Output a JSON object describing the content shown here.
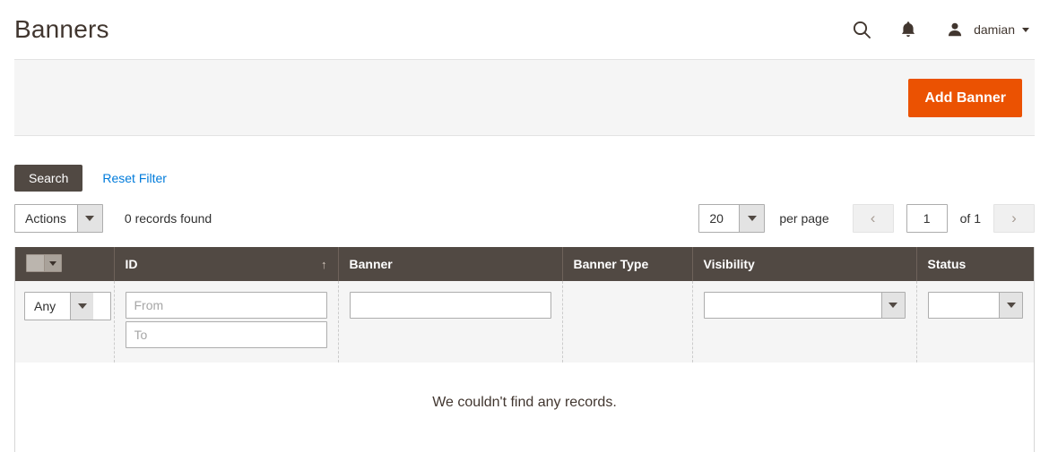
{
  "header": {
    "title": "Banners",
    "search_icon": "search-icon",
    "notifications_icon": "bell-icon",
    "user_icon": "user-icon",
    "user_name": "damian"
  },
  "page_actions": {
    "add_button_label": "Add Banner",
    "accent_color": "#eb5202"
  },
  "filter_actions": {
    "search_label": "Search",
    "reset_label": "Reset Filter",
    "search_bg": "#514943",
    "reset_link_color": "#007bdb"
  },
  "grid_toolbar": {
    "actions_label": "Actions",
    "records_found": "0 records found",
    "per_page_value": "20",
    "per_page_label": "per page",
    "prev_icon": "‹",
    "next_icon": "›",
    "current_page": "1",
    "of_label": "of 1"
  },
  "grid": {
    "header_bg": "#514943",
    "columns": [
      {
        "label": "",
        "name": "massaction"
      },
      {
        "label": "ID",
        "name": "id",
        "sort": "↑"
      },
      {
        "label": "Banner",
        "name": "banner"
      },
      {
        "label": "Banner Type",
        "name": "banner-type"
      },
      {
        "label": "Visibility",
        "name": "visibility"
      },
      {
        "label": "Status",
        "name": "status"
      }
    ],
    "filters": {
      "massaction_value": "Any",
      "id_from_placeholder": "From",
      "id_to_placeholder": "To",
      "banner_value": "",
      "visibility_value": "",
      "status_value": ""
    },
    "empty_message": "We couldn't find any records."
  }
}
